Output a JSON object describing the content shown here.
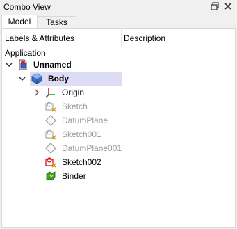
{
  "window": {
    "title": "Combo View"
  },
  "tabs": [
    {
      "label": "Model"
    },
    {
      "label": "Tasks"
    }
  ],
  "tree": {
    "headers": {
      "labels": "Labels & Attributes",
      "description": "Description"
    },
    "root_label": "Application",
    "items": [
      {
        "label": "Unnamed",
        "icon": "document-icon"
      },
      {
        "label": "Body",
        "icon": "body-icon"
      },
      {
        "label": "Origin",
        "icon": "origin-icon"
      },
      {
        "label": "Sketch",
        "icon": "sketch-icon"
      },
      {
        "label": "DatumPlane",
        "icon": "datum-plane-icon"
      },
      {
        "label": "Sketch001",
        "icon": "sketch-icon"
      },
      {
        "label": "DatumPlane001",
        "icon": "datum-plane-icon"
      },
      {
        "label": "Sketch002",
        "icon": "sketch-error-icon"
      },
      {
        "label": "Binder",
        "icon": "binder-icon"
      }
    ]
  },
  "colors": {
    "selection": "#dcdcf4",
    "disabled_text": "#9a9a9a",
    "error": "#d40000"
  }
}
